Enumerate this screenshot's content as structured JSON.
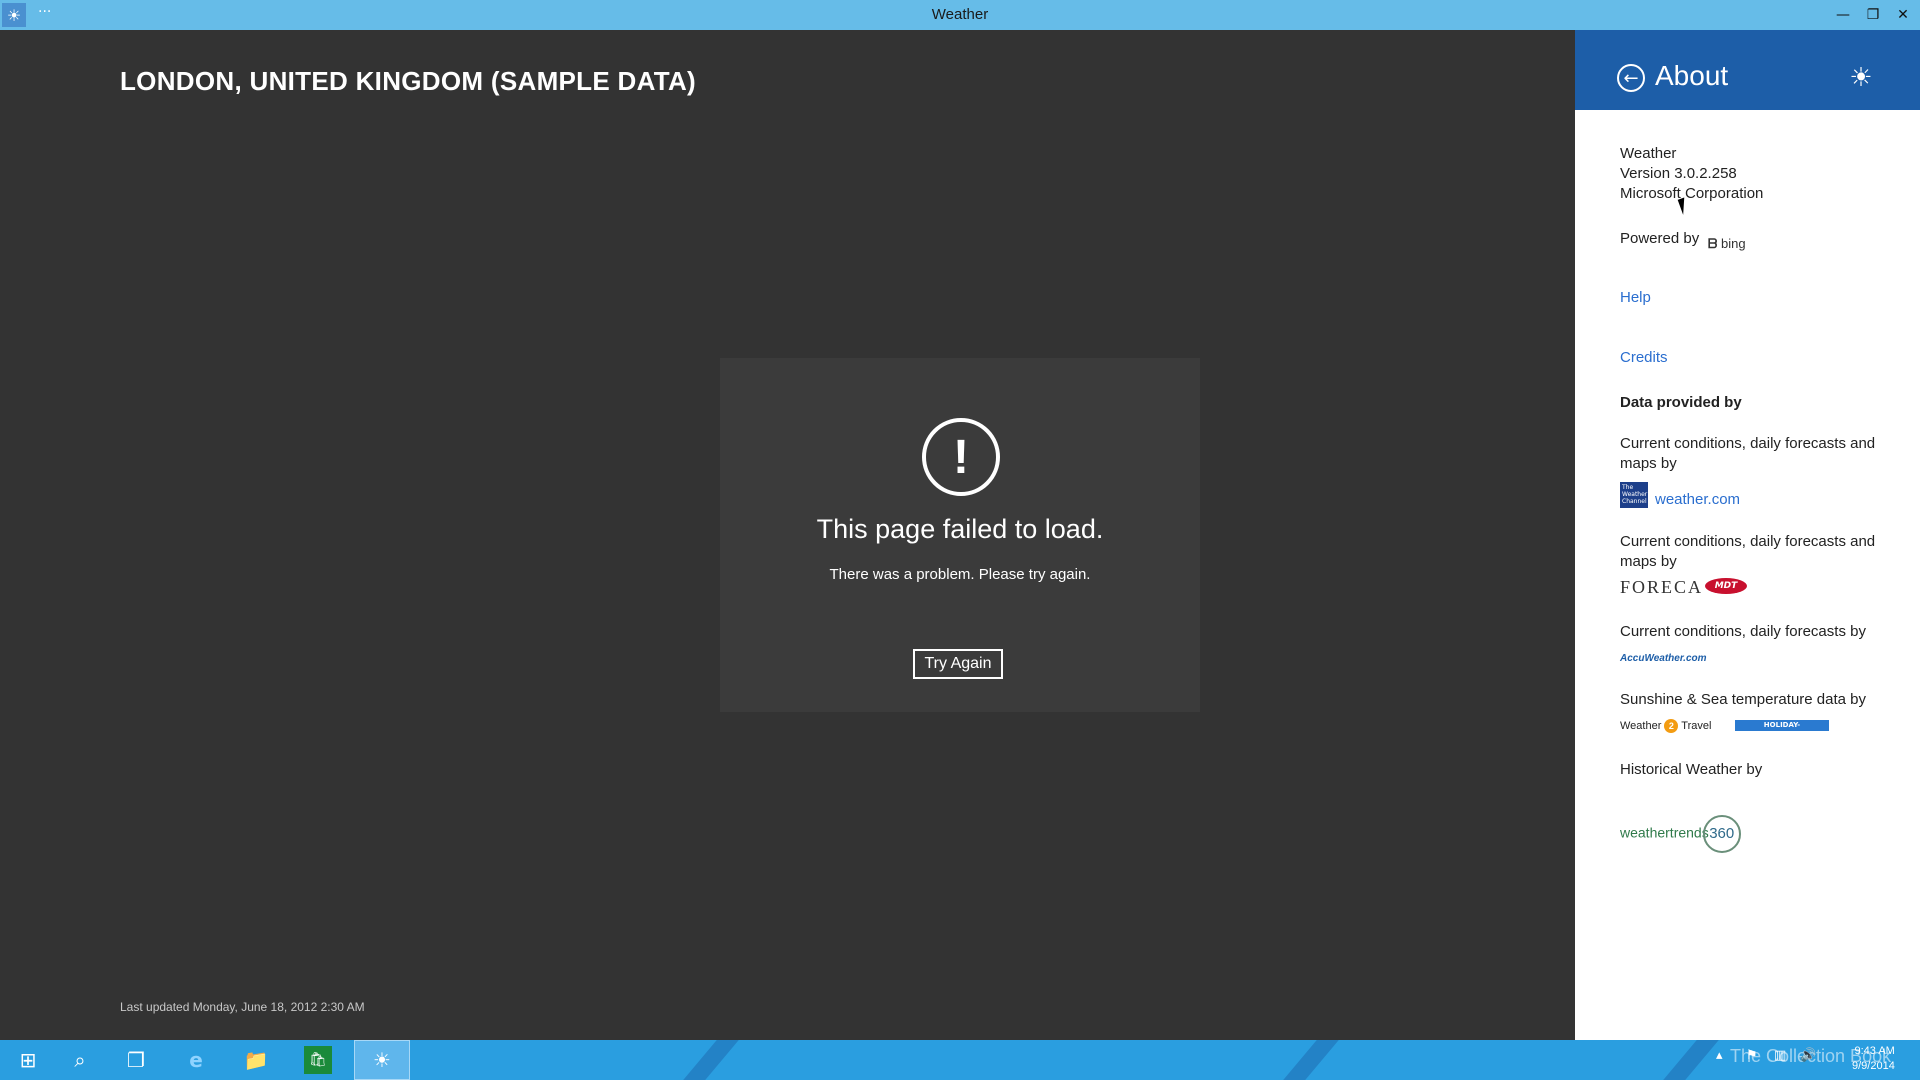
{
  "window": {
    "title": "Weather",
    "menu_dots": "···"
  },
  "main": {
    "city_title": "LONDON, UNITED KINGDOM (SAMPLE DATA)",
    "error": {
      "title": "This page failed to load.",
      "message": "There was a problem. Please try again.",
      "try_again_label": "Try Again"
    },
    "last_updated": "Last updated Monday, June 18, 2012 2:30 AM"
  },
  "about_panel": {
    "title": "About",
    "app_name": "Weather",
    "version": "Version 3.0.2.258",
    "publisher": "Microsoft Corporation",
    "powered_by": "Powered by",
    "bing_logo_text": "bing",
    "help_link": "Help",
    "credits_link": "Credits",
    "data_provided_by": "Data provided by",
    "providers": [
      {
        "text": "Current conditions, daily forecasts and maps by",
        "logo": "The Weather Channel",
        "link": "weather.com"
      },
      {
        "text": "Current conditions, daily forecasts and maps by",
        "logo": "FORECA",
        "logo2": "MDT"
      },
      {
        "text": "Current conditions, daily forecasts by",
        "logo": "AccuWeather.com"
      },
      {
        "text": "Sunshine & Sea temperature data by",
        "logo": "Weather 2 Travel",
        "logo2": "HOLIDAY-WEATHER.COM"
      },
      {
        "text": "Historical Weather by",
        "logo": "weathertrends360"
      }
    ]
  },
  "taskbar": {
    "clock_time": "9:43 AM",
    "clock_date": "9/9/2014",
    "watermark": "The Collection Book",
    "accent": "#2a9ee0"
  }
}
